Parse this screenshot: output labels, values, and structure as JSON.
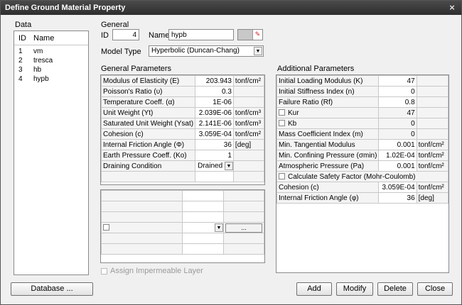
{
  "window": {
    "title": "Define Ground Material Property",
    "close_glyph": "×"
  },
  "data_panel": {
    "label": "Data",
    "columns": [
      "ID",
      "Name"
    ],
    "rows": [
      {
        "id": "1",
        "name": "vm"
      },
      {
        "id": "2",
        "name": "tresca"
      },
      {
        "id": "3",
        "name": "hb"
      },
      {
        "id": "4",
        "name": "hypb"
      }
    ]
  },
  "general": {
    "label": "General",
    "id_label": "ID",
    "id_value": "4",
    "name_label": "Name",
    "name_value": "hypb",
    "model_type_label": "Model Type",
    "model_type_value": "Hyperbolic (Duncan-Chang)"
  },
  "general_params": {
    "label": "General Parameters",
    "rows": [
      {
        "name": "Modulus of Elasticity (E)",
        "value": "203.943",
        "unit": "tonf/cm²"
      },
      {
        "name": "Poisson's Ratio (υ)",
        "value": "0.3",
        "unit": ""
      },
      {
        "name": "Temperature Coeff. (α)",
        "value": "1E-06",
        "unit": ""
      },
      {
        "name": "Unit Weight (Yt)",
        "value": "2.039E-06",
        "unit": "tonf/cm³"
      },
      {
        "name": "Saturated Unit Weight (Ysat)",
        "value": "2.141E-06",
        "unit": "tonf/cm³"
      },
      {
        "name": "Cohesion (c)",
        "value": "3.059E-04",
        "unit": "tonf/cm²"
      },
      {
        "name": "Internal Friction Angle (Φ)",
        "value": "36",
        "unit": "[deg]"
      },
      {
        "name": "Earth Pressure Coeff. (Ko)",
        "value": "1",
        "unit": ""
      }
    ],
    "draining_label": "Draining Condition",
    "draining_value": "Drained",
    "ellipsis_label": "...",
    "assign_impermeable": "Assign Impermeable Layer"
  },
  "additional_params": {
    "label": "Additional Parameters",
    "initial_loading": {
      "name": "Initial Loading Modulus (K)",
      "value": "47"
    },
    "initial_stiffness": {
      "name": "Initial Stiffness Index (n)",
      "value": "0"
    },
    "failure_ratio": {
      "name": "Failure Ratio (Rf)",
      "value": "0.8"
    },
    "kur": {
      "name": "Kur",
      "value": "47"
    },
    "kb": {
      "name": "Kb",
      "value": "0"
    },
    "mass_coeff": {
      "name": "Mass Coefficient Index (m)",
      "value": "0"
    },
    "min_tangential": {
      "name": "Min. Tangential Modulus",
      "value": "0.001",
      "unit": "tonf/cm²"
    },
    "min_confining": {
      "name": "Min. Confining Pressure (σmin)",
      "value": "1.02E-04",
      "unit": "tonf/cm²"
    },
    "atmospheric": {
      "name": "Atmospheric Pressure (Pa)",
      "value": "0.001",
      "unit": "tonf/cm²"
    },
    "safety_factor": "Calculate Safety Factor (Mohr-Coulomb)",
    "cohesion": {
      "name": "Cohesion (c)",
      "value": "3.059E-04",
      "unit": "tonf/cm²"
    },
    "friction": {
      "name": "Internal Friction Angle (φ)",
      "value": "36",
      "unit": "[deg]"
    }
  },
  "buttons": {
    "database": "Database ...",
    "add": "Add",
    "modify": "Modify",
    "delete": "Delete",
    "close": "Close"
  }
}
